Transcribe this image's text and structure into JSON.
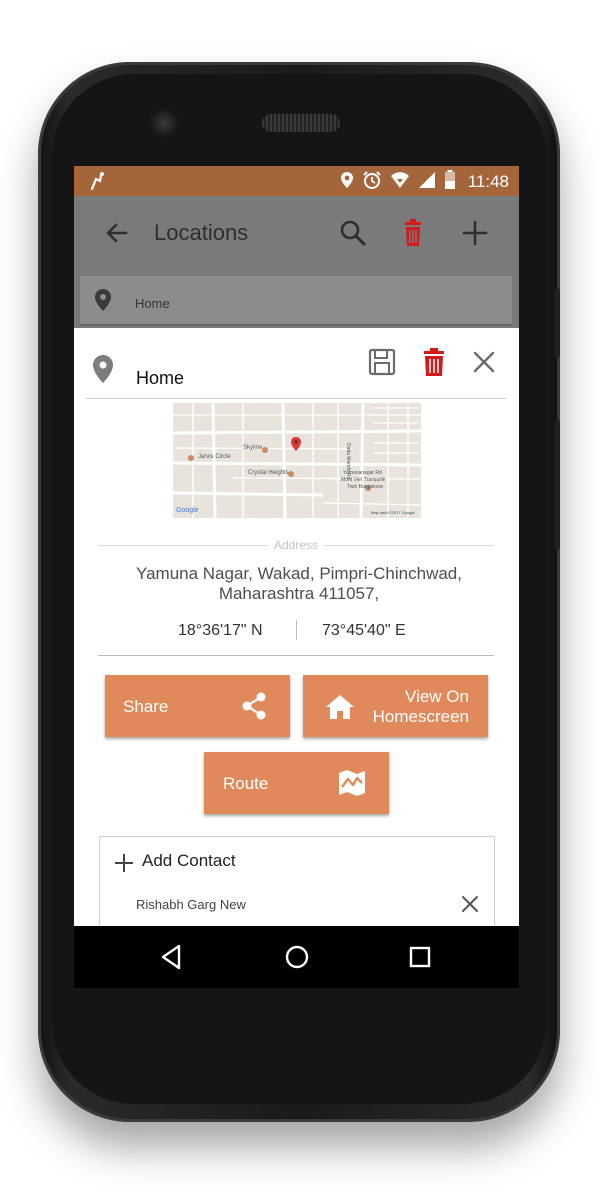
{
  "statusbar": {
    "time": "11:48"
  },
  "appbar": {
    "title": "Locations"
  },
  "searchbar": {
    "value": "Home"
  },
  "detail": {
    "name": "Home"
  },
  "map": {
    "labels": {
      "skyline": "Skyline",
      "jarvis": "Jarvis Circle",
      "crystal": "Crystal Heights",
      "yamunanagar": "Yamunanagar Rd",
      "montvert1": "Mont Vert Tranquille",
      "montvert2": "Twin Bungalows",
      "road": "Datta Mandir Rd",
      "google": "Google",
      "mapdata": "Map data ©2017 Google"
    }
  },
  "address": {
    "label": "Address",
    "line1": "Yamuna Nagar, Wakad, Pimpri-Chinchwad,",
    "line2": "Maharashtra 411057,"
  },
  "coordinates": {
    "lat": "18°36'17\" N",
    "lng": "73°45'40\" E"
  },
  "buttons": {
    "share": "Share",
    "homescreen_line1": "View On",
    "homescreen_line2": "Homescreen",
    "route": "Route"
  },
  "contacts": {
    "add_label": "Add Contact",
    "items": [
      {
        "name": "Rishabh Garg New"
      }
    ]
  },
  "colors": {
    "statusbar": "#a5653a",
    "appbar": "#7a7a7a",
    "accent_button": "#e0895a",
    "delete_icon": "#d11a1a"
  }
}
